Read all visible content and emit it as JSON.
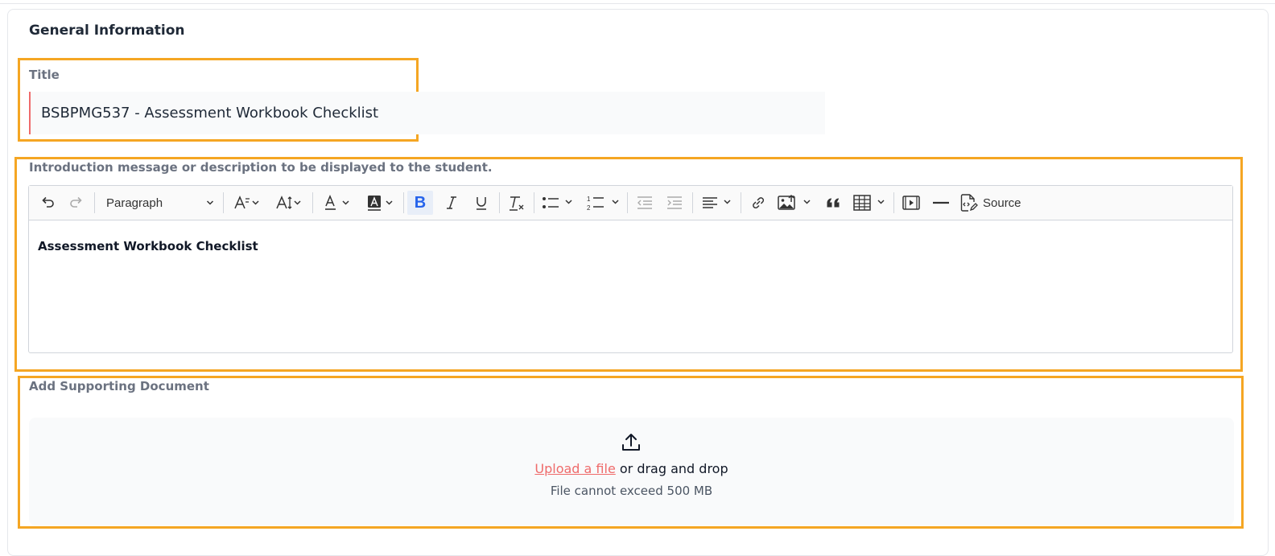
{
  "section": {
    "title": "General Information"
  },
  "title_field": {
    "label": "Title",
    "value": "BSBPMG537 - Assessment Workbook Checklist"
  },
  "intro_field": {
    "label": "Introduction message or description to be displayed to the student.",
    "toolbar": {
      "paragraph_select": "Paragraph",
      "bold": "B",
      "source": "Source"
    },
    "content": "Assessment Workbook Checklist"
  },
  "supporting_doc": {
    "label": "Add Supporting Document",
    "upload_link": "Upload a file",
    "upload_rest": " or drag and drop",
    "limit": "File cannot exceed 500 MB"
  },
  "colors": {
    "highlight": "#f5a623",
    "link": "#ef6b6b",
    "bold_active": "#2563eb"
  }
}
